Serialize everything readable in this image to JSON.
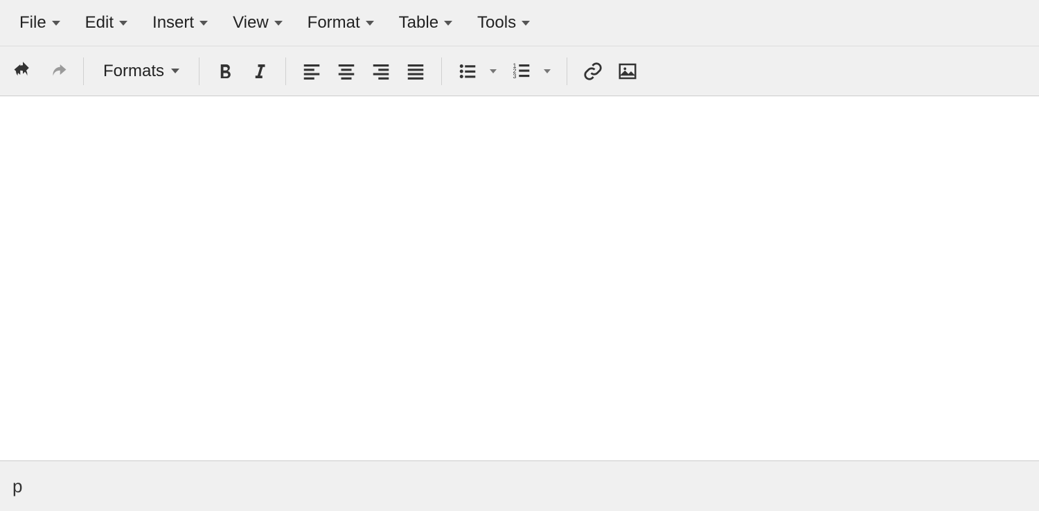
{
  "menubar": {
    "items": [
      {
        "label": "File"
      },
      {
        "label": "Edit"
      },
      {
        "label": "Insert"
      },
      {
        "label": "View"
      },
      {
        "label": "Format"
      },
      {
        "label": "Table"
      },
      {
        "label": "Tools"
      }
    ]
  },
  "toolbar": {
    "formats_label": "Formats"
  },
  "statusbar": {
    "path": "p"
  }
}
